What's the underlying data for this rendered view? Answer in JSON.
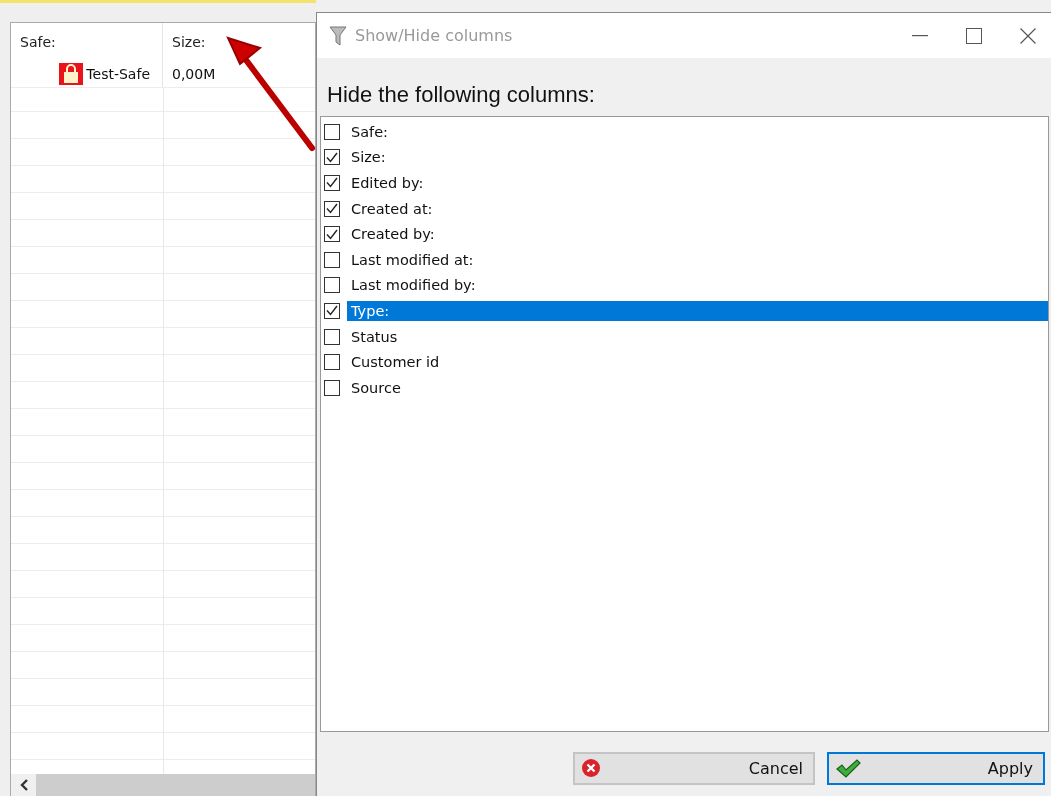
{
  "table": {
    "columns": [
      "Safe:",
      "Size:"
    ],
    "rows": [
      {
        "safe": "Test-Safe",
        "size": "0,00M"
      }
    ]
  },
  "dialog": {
    "title": "Show/Hide columns",
    "heading": "Hide the following columns:",
    "items": [
      {
        "label": "Safe:",
        "checked": false,
        "selected": false
      },
      {
        "label": "Size:",
        "checked": true,
        "selected": false
      },
      {
        "label": "Edited by:",
        "checked": true,
        "selected": false
      },
      {
        "label": "Created at:",
        "checked": true,
        "selected": false
      },
      {
        "label": "Created by:",
        "checked": true,
        "selected": false
      },
      {
        "label": "Last modified at:",
        "checked": false,
        "selected": false
      },
      {
        "label": "Last modified by:",
        "checked": false,
        "selected": false
      },
      {
        "label": "Type:",
        "checked": true,
        "selected": true
      },
      {
        "label": "Status",
        "checked": false,
        "selected": false
      },
      {
        "label": "Customer id",
        "checked": false,
        "selected": false
      },
      {
        "label": "Source",
        "checked": false,
        "selected": false
      }
    ],
    "buttons": [
      {
        "label": "Cancel",
        "kind": "cancel"
      },
      {
        "label": "Apply",
        "kind": "apply"
      }
    ]
  }
}
